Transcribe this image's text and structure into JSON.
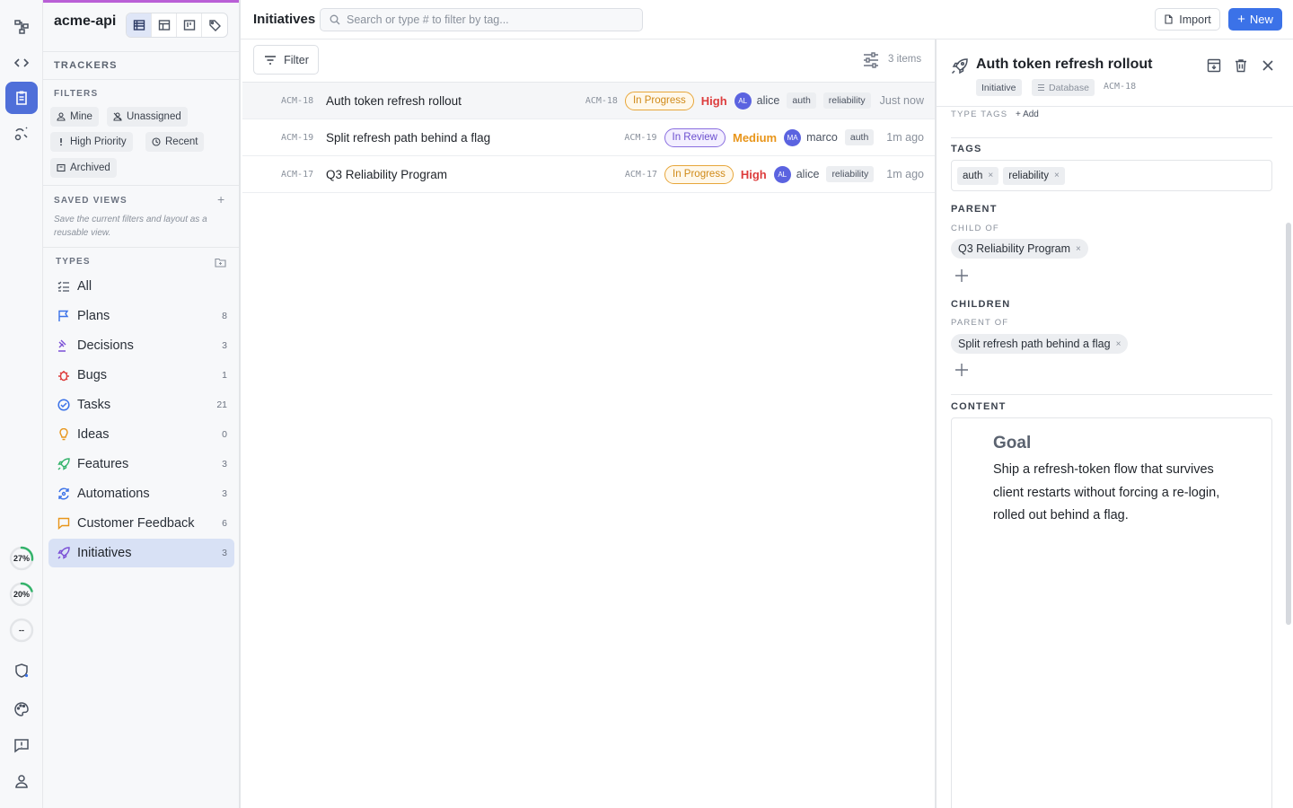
{
  "workspace": {
    "name": "acme-api"
  },
  "icon_rail": {
    "top_icons": [
      "workflow-icon",
      "code-icon",
      "tracker-icon",
      "agents-icon"
    ],
    "rings": [
      {
        "label": "27%",
        "value": 0.27,
        "color": "#34b36b"
      },
      {
        "label": "20%",
        "value": 0.2,
        "color": "#34b36b"
      },
      {
        "label": "--",
        "value": 0,
        "color": "#c9ccd1"
      }
    ],
    "bottom_icons": [
      "shield-icon",
      "palette-icon",
      "feedback-icon",
      "user-icon"
    ]
  },
  "sidebar": {
    "trackers_label": "TRACKERS",
    "filters_label": "FILTERS",
    "filters": [
      "Mine",
      "Unassigned",
      "High Priority",
      "Recent",
      "Archived"
    ],
    "saved_views_label": "SAVED VIEWS",
    "saved_views_plus": "+",
    "saved_views_hint": "Save the current filters and layout as a reusable view.",
    "types_label": "TYPES",
    "types": [
      {
        "label": "All",
        "count": "",
        "icon": "all-icon",
        "color": "#4a5260"
      },
      {
        "label": "Plans",
        "count": "8",
        "icon": "flag-icon",
        "color": "#3b72e8"
      },
      {
        "label": "Decisions",
        "count": "3",
        "icon": "gavel-icon",
        "color": "#7a4fd6"
      },
      {
        "label": "Bugs",
        "count": "1",
        "icon": "bug-icon",
        "color": "#dd3d3d"
      },
      {
        "label": "Tasks",
        "count": "21",
        "icon": "check-circle-icon",
        "color": "#3b72e8"
      },
      {
        "label": "Ideas",
        "count": "0",
        "icon": "lightbulb-icon",
        "color": "#e8951a"
      },
      {
        "label": "Features",
        "count": "3",
        "icon": "rocket-icon",
        "color": "#34b36b"
      },
      {
        "label": "Automations",
        "count": "3",
        "icon": "automation-icon",
        "color": "#3b72e8"
      },
      {
        "label": "Customer Feedback",
        "count": "6",
        "icon": "message-icon",
        "color": "#e8951a"
      },
      {
        "label": "Initiatives",
        "count": "3",
        "icon": "rocket-icon",
        "color": "#7a4fd6",
        "active": true
      }
    ]
  },
  "topbar": {
    "title": "Initiatives",
    "search_placeholder": "Search or type # to filter by tag...",
    "import_label": "Import",
    "new_label": "New"
  },
  "list": {
    "filter_label": "Filter",
    "items_count": "3 items",
    "rows": [
      {
        "id": "ACM-18",
        "title": "Auth token refresh rollout",
        "status": "In Progress",
        "status_kind": "progress",
        "priority": "High",
        "priority_kind": "high",
        "avatar": "AL",
        "user": "alice",
        "tags": [
          "auth",
          "reliability"
        ],
        "when": "Just now",
        "selected": true
      },
      {
        "id": "ACM-19",
        "title": "Split refresh path behind a flag",
        "status": "In Review",
        "status_kind": "review",
        "priority": "Medium",
        "priority_kind": "medium",
        "avatar": "MA",
        "user": "marco",
        "tags": [
          "auth"
        ],
        "when": "1m ago"
      },
      {
        "id": "ACM-17",
        "title": "Q3 Reliability Program",
        "status": "In Progress",
        "status_kind": "progress",
        "priority": "High",
        "priority_kind": "high",
        "avatar": "AL",
        "user": "alice",
        "tags": [
          "reliability"
        ],
        "when": "1m ago"
      }
    ]
  },
  "detail": {
    "title": "Auth token refresh rollout",
    "type_badge": "Initiative",
    "source_badge": "Database",
    "id": "ACM-18",
    "type_tags_label": "TYPE TAGS",
    "type_tags_add": "+ Add",
    "tags_label": "TAGS",
    "tags": [
      "auth",
      "reliability"
    ],
    "parent_label": "PARENT",
    "child_of_label": "CHILD OF",
    "parent_item": "Q3 Reliability Program",
    "children_label": "CHILDREN",
    "parent_of_label": "PARENT OF",
    "child_item": "Split refresh path behind a flag",
    "content_label": "CONTENT",
    "content_heading": "Goal",
    "content_body": "Ship a refresh-token flow that survives client restarts without forcing a re-login, rolled out behind a flag."
  }
}
